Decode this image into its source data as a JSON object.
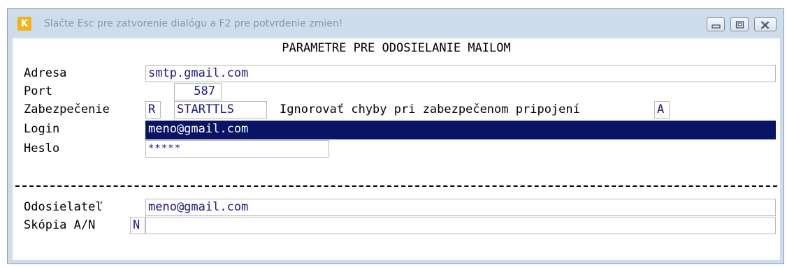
{
  "window": {
    "title": "Slačte Esc pre zatvorenie dialógu a F2 pre potvrdenie zmien!",
    "app_icon_letter": "K",
    "accent_color": "#f2b21c"
  },
  "form": {
    "heading": "PARAMETRE PRE ODOSIELANIE MAILOM",
    "adresa": {
      "label": "Adresa",
      "value": "smtp.gmail.com"
    },
    "port": {
      "label": "Port",
      "value": "587"
    },
    "zabezpecenie": {
      "label": "Zabezpečenie",
      "code": "R",
      "value": "STARTTLS",
      "ignore_label": "Ignorovať chyby pri zabezpečenom pripojení",
      "ignore_value": "A"
    },
    "login": {
      "label": "Login",
      "value": "meno@gmail.com"
    },
    "heslo": {
      "label": "Heslo",
      "value": "*****"
    },
    "odosielatel": {
      "label": "Odosielateľ",
      "value": "meno@gmail.com"
    },
    "kopia": {
      "label": "Skópia A/N",
      "flag": "N",
      "value": ""
    }
  },
  "colors": {
    "selected_bg": "#0a1464",
    "field_text": "#1a1a7a"
  }
}
